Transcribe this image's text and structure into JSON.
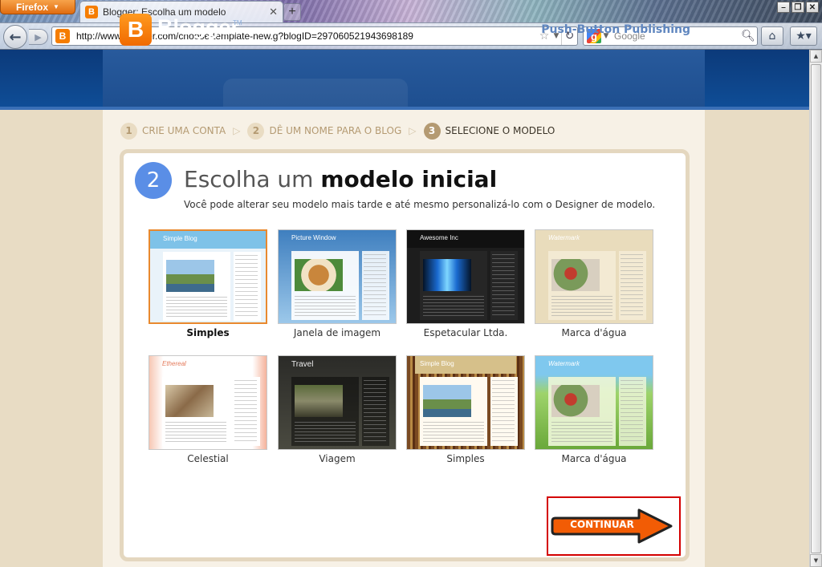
{
  "browser": {
    "app_button": "Firefox",
    "tab_title": "Blogger: Escolha um modelo",
    "url": "http://www.blogger.com/choose-template-new.g?blogID=297060521943698189",
    "search_engine": "Google",
    "icons": [
      "back-icon",
      "forward-icon",
      "blogger-favicon",
      "bookmark-star-icon",
      "reload-icon",
      "google-icon",
      "search-icon",
      "home-icon",
      "bookmarks-icon"
    ]
  },
  "header": {
    "logo_letter": "B",
    "logo_text": "Blogger",
    "logo_tm": "TM",
    "tagline": "Push-Button Publishing",
    "brand_color": "#f57d00"
  },
  "steps": [
    {
      "num": "1",
      "label": "CRIE UMA CONTA",
      "active": false
    },
    {
      "num": "2",
      "label": "DÊ UM NOME PARA O BLOG",
      "active": false
    },
    {
      "num": "3",
      "label": "SELECIONE O MODELO",
      "active": true
    }
  ],
  "section": {
    "badge": "2",
    "title_prefix": "Escolha um",
    "title_bold": "modelo inicial",
    "subtitle": "Você pode alterar seu modelo mais tarde e até mesmo personalizá-lo com o Designer de modelo."
  },
  "templates": [
    {
      "name": "Simples",
      "thumb_title": "Simple Blog",
      "selected": true
    },
    {
      "name": "Janela de imagem",
      "thumb_title": "Picture Window",
      "selected": false
    },
    {
      "name": "Espetacular Ltda.",
      "thumb_title": "Awesome Inc",
      "selected": false
    },
    {
      "name": "Marca d'água",
      "thumb_title": "Watermark",
      "selected": false
    },
    {
      "name": "Celestial",
      "thumb_title": "Ethereal",
      "selected": false
    },
    {
      "name": "Viagem",
      "thumb_title": "Travel",
      "selected": false
    },
    {
      "name": "Simples",
      "thumb_title": "Simple Blog",
      "selected": false
    },
    {
      "name": "Marca d'água",
      "thumb_title": "Watermark",
      "selected": false
    }
  ],
  "continue_button": {
    "label": "CONTINUAR",
    "color": "#f25c05"
  }
}
